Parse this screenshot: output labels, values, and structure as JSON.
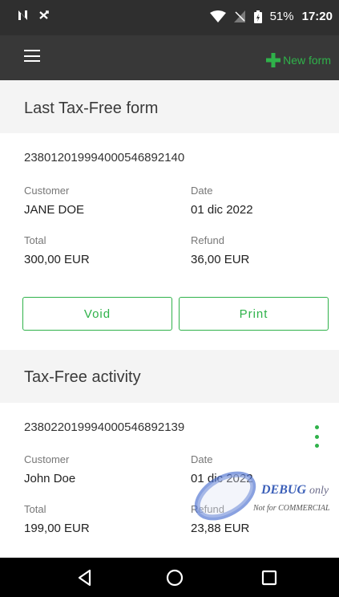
{
  "status_bar": {
    "left_icons": [
      "n-logo-icon",
      "shuffle-icon"
    ],
    "battery": "51%",
    "time": "17:20"
  },
  "app_bar": {
    "menu_icon": "hamburger-icon",
    "new_form_label": "New form",
    "new_form_icon": "plus-icon"
  },
  "last_form": {
    "header": "Last Tax-Free form",
    "form_id": "23801201999400054689214​0",
    "customer_label": "Customer",
    "customer": "JANE DOE",
    "date_label": "Date",
    "date": "01 dic 2022",
    "total_label": "Total",
    "total": "300,00 EUR",
    "refund_label": "Refund",
    "refund": "36,00 EUR",
    "void_label": "Void",
    "print_label": "Print"
  },
  "activity": {
    "header": "Tax-Free activity",
    "items": [
      {
        "form_id": "238022019994000546892139",
        "customer_label": "Customer",
        "customer": "John Doe",
        "date_label": "Date",
        "date": "01 dic 2022",
        "total_label": "Total",
        "total": "199,00 EUR",
        "refund_label": "Refund",
        "refund": "23,88 EUR"
      }
    ]
  },
  "watermark": {
    "debug": "DEBUG",
    "only": "only",
    "note": "Not for COMMERCIAL"
  },
  "colors": {
    "accent": "#2fb24a",
    "app_bar": "#383838",
    "section_bg": "#f4f4f4"
  }
}
